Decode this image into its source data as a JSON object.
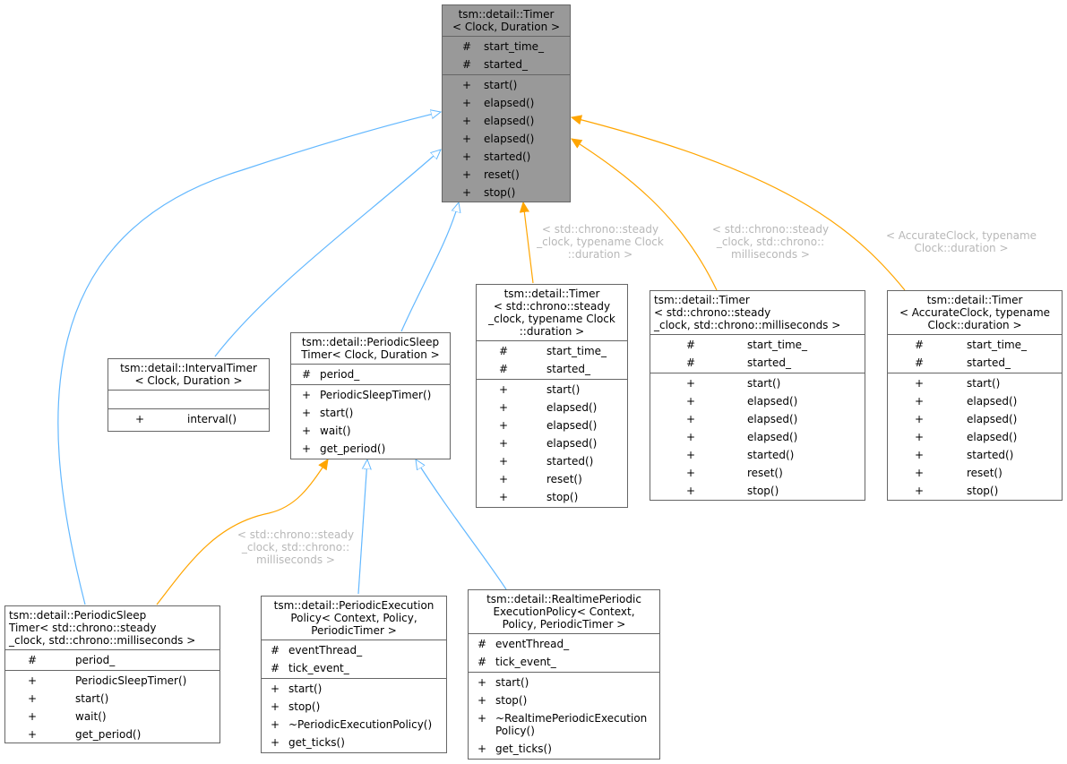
{
  "colors": {
    "inheritance_edge": "#63b8ff",
    "template_edge": "#ffa500",
    "root_fill": "#999999",
    "node_border": "#666666",
    "edge_label": "#b8b8b8"
  },
  "nodes": {
    "timer": {
      "title": "tsm::detail::Timer\n< Clock, Duration >",
      "attributes": [
        {
          "vis": "#",
          "name": "start_time_"
        },
        {
          "vis": "#",
          "name": "started_"
        }
      ],
      "methods": [
        {
          "vis": "+",
          "name": "start()"
        },
        {
          "vis": "+",
          "name": "elapsed()"
        },
        {
          "vis": "+",
          "name": "elapsed()"
        },
        {
          "vis": "+",
          "name": "elapsed()"
        },
        {
          "vis": "+",
          "name": "started()"
        },
        {
          "vis": "+",
          "name": "reset()"
        },
        {
          "vis": "+",
          "name": "stop()"
        }
      ]
    },
    "interval_timer": {
      "title": "tsm::detail::IntervalTimer\n< Clock, Duration >",
      "attributes": [],
      "methods": [
        {
          "vis": "+",
          "name": "interval()"
        }
      ]
    },
    "periodic_sleep_timer": {
      "title": "tsm::detail::PeriodicSleep\nTimer< Clock, Duration >",
      "attributes": [
        {
          "vis": "#",
          "name": "period_"
        }
      ],
      "methods": [
        {
          "vis": "+",
          "name": "PeriodicSleepTimer()"
        },
        {
          "vis": "+",
          "name": "start()"
        },
        {
          "vis": "+",
          "name": "wait()"
        },
        {
          "vis": "+",
          "name": "get_period()"
        }
      ]
    },
    "timer_steady_duration": {
      "title": "tsm::detail::Timer\n< std::chrono::steady\n_clock, typename Clock\n::duration >",
      "attributes": [
        {
          "vis": "#",
          "name": "start_time_"
        },
        {
          "vis": "#",
          "name": "started_"
        }
      ],
      "methods": [
        {
          "vis": "+",
          "name": "start()"
        },
        {
          "vis": "+",
          "name": "elapsed()"
        },
        {
          "vis": "+",
          "name": "elapsed()"
        },
        {
          "vis": "+",
          "name": "elapsed()"
        },
        {
          "vis": "+",
          "name": "started()"
        },
        {
          "vis": "+",
          "name": "reset()"
        },
        {
          "vis": "+",
          "name": "stop()"
        }
      ]
    },
    "timer_steady_ms": {
      "title": "tsm::detail::Timer\n< std::chrono::steady\n_clock, std::chrono::milliseconds >",
      "attributes": [
        {
          "vis": "#",
          "name": "start_time_"
        },
        {
          "vis": "#",
          "name": "started_"
        }
      ],
      "methods": [
        {
          "vis": "+",
          "name": "start()"
        },
        {
          "vis": "+",
          "name": "elapsed()"
        },
        {
          "vis": "+",
          "name": "elapsed()"
        },
        {
          "vis": "+",
          "name": "elapsed()"
        },
        {
          "vis": "+",
          "name": "started()"
        },
        {
          "vis": "+",
          "name": "reset()"
        },
        {
          "vis": "+",
          "name": "stop()"
        }
      ]
    },
    "timer_accurate": {
      "title": "tsm::detail::Timer\n< AccurateClock, typename\nClock::duration >",
      "attributes": [
        {
          "vis": "#",
          "name": "start_time_"
        },
        {
          "vis": "#",
          "name": "started_"
        }
      ],
      "methods": [
        {
          "vis": "+",
          "name": "start()"
        },
        {
          "vis": "+",
          "name": "elapsed()"
        },
        {
          "vis": "+",
          "name": "elapsed()"
        },
        {
          "vis": "+",
          "name": "elapsed()"
        },
        {
          "vis": "+",
          "name": "started()"
        },
        {
          "vis": "+",
          "name": "reset()"
        },
        {
          "vis": "+",
          "name": "stop()"
        }
      ]
    },
    "periodic_sleep_timer_steady_ms": {
      "title": "tsm::detail::PeriodicSleep\nTimer< std::chrono::steady\n_clock, std::chrono::milliseconds >",
      "attributes": [
        {
          "vis": "#",
          "name": "period_"
        }
      ],
      "methods": [
        {
          "vis": "+",
          "name": "PeriodicSleepTimer()"
        },
        {
          "vis": "+",
          "name": "start()"
        },
        {
          "vis": "+",
          "name": "wait()"
        },
        {
          "vis": "+",
          "name": "get_period()"
        }
      ]
    },
    "periodic_execution_policy": {
      "title": "tsm::detail::PeriodicExecution\nPolicy< Context, Policy,\nPeriodicTimer >",
      "attributes": [
        {
          "vis": "#",
          "name": "eventThread_"
        },
        {
          "vis": "#",
          "name": "tick_event_"
        }
      ],
      "methods": [
        {
          "vis": "+",
          "name": "start()"
        },
        {
          "vis": "+",
          "name": "stop()"
        },
        {
          "vis": "+",
          "name": "~PeriodicExecutionPolicy()"
        },
        {
          "vis": "+",
          "name": "get_ticks()"
        }
      ]
    },
    "realtime_periodic_execution_policy": {
      "title": "tsm::detail::RealtimePeriodic\nExecutionPolicy< Context,\nPolicy, PeriodicTimer >",
      "attributes": [
        {
          "vis": "#",
          "name": "eventThread_"
        },
        {
          "vis": "#",
          "name": "tick_event_"
        }
      ],
      "methods": [
        {
          "vis": "+",
          "name": "start()"
        },
        {
          "vis": "+",
          "name": "stop()"
        },
        {
          "vis": "+",
          "name": "~RealtimePeriodicExecution\nPolicy()"
        },
        {
          "vis": "+",
          "name": "get_ticks()"
        }
      ]
    }
  },
  "edge_labels": {
    "steady_duration": "< std::chrono::steady\n_clock, typename Clock\n::duration >",
    "steady_ms": "< std::chrono::steady\n_clock, std::chrono::\nmilliseconds >",
    "accurate": "< AccurateClock, typename\nClock::duration >",
    "pst_steady_ms": "< std::chrono::steady\n_clock, std::chrono::\nmilliseconds >"
  },
  "edges": [
    {
      "from": "interval_timer",
      "to": "timer",
      "kind": "inheritance"
    },
    {
      "from": "periodic_sleep_timer",
      "to": "timer",
      "kind": "inheritance"
    },
    {
      "from": "periodic_sleep_timer_steady_ms",
      "to": "timer",
      "kind": "inheritance"
    },
    {
      "from": "timer_steady_duration",
      "to": "timer",
      "kind": "template",
      "label": "steady_duration"
    },
    {
      "from": "timer_steady_ms",
      "to": "timer",
      "kind": "template",
      "label": "steady_ms"
    },
    {
      "from": "timer_accurate",
      "to": "timer",
      "kind": "template",
      "label": "accurate"
    },
    {
      "from": "periodic_sleep_timer_steady_ms",
      "to": "periodic_sleep_timer",
      "kind": "template",
      "label": "pst_steady_ms"
    },
    {
      "from": "periodic_execution_policy",
      "to": "periodic_sleep_timer",
      "kind": "inheritance"
    },
    {
      "from": "realtime_periodic_execution_policy",
      "to": "periodic_sleep_timer",
      "kind": "inheritance"
    }
  ]
}
